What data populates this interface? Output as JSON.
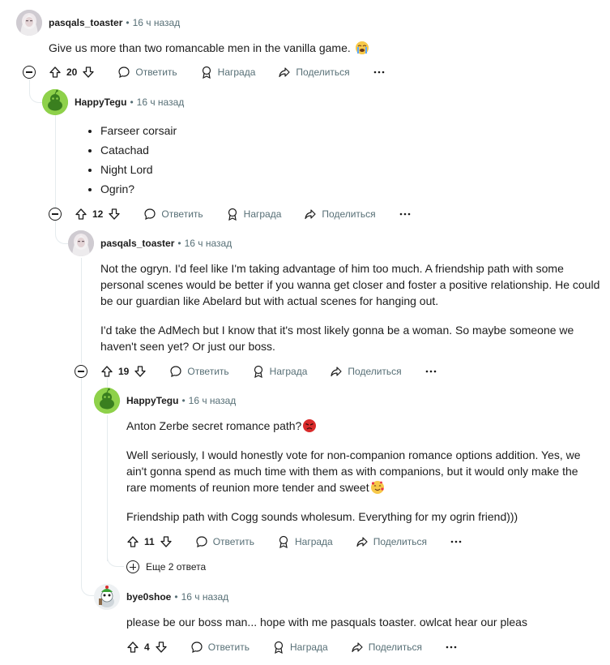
{
  "ui": {
    "reply": "Ответить",
    "award": "Награда",
    "share": "Поделиться"
  },
  "comments": [
    {
      "author": "pasqals_toaster",
      "time": "16 ч назад",
      "text": "Give us more than two romancable men in the vanilla game.",
      "votes": "20"
    },
    {
      "author": "HappyTegu",
      "time": "16 ч назад",
      "bullets": [
        "Farseer corsair",
        "Catachad",
        "Night Lord",
        "Ogrin?"
      ],
      "votes": "12"
    },
    {
      "author": "pasqals_toaster",
      "time": "16 ч назад",
      "paragraphs": [
        "Not the ogryn. I'd feel like I'm taking advantage of him too much. A friendship path with some personal scenes would be better if you wanna get closer and foster a positive relationship. He could be our guardian like Abelard but with actual scenes for hanging out.",
        "I'd take the AdMech but I know that it's most likely gonna be a woman. So maybe someone we haven't seen yet? Or just our boss."
      ],
      "votes": "19"
    },
    {
      "author": "HappyTegu",
      "time": "16 ч назад",
      "paragraphs": [
        "Anton Zerbe secret romance path?",
        "Well seriously, I would honestly vote for non-companion romance options addition. Yes, we ain't gonna spend as much time with them as with companions, but it would only make the rare moments of reunion more tender and sweet",
        "Friendship path with Cogg sounds wholesum. Everything for my ogrin friend)))"
      ],
      "votes": "11",
      "more_replies": "Еще 2 ответа"
    },
    {
      "author": "bye0shoe",
      "time": "16 ч назад",
      "text": "please be our boss man... hope with me pasquals toaster. owlcat hear our pleas",
      "votes": "4"
    }
  ]
}
